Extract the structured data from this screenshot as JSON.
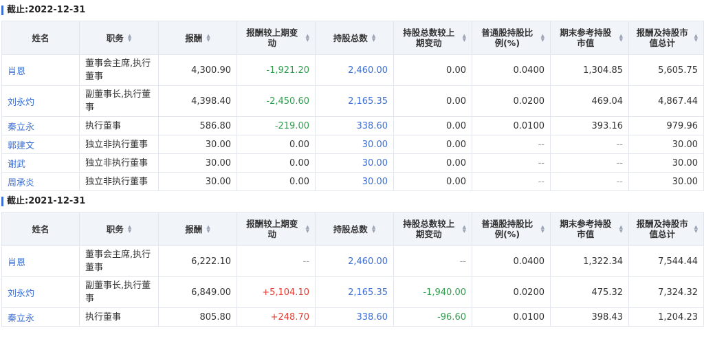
{
  "headers": [
    "姓名",
    "职务",
    "报酬",
    "报酬较上期变动",
    "持股总数",
    "持股总数较上期变动",
    "普通股持股比例(%)",
    "期末参考持股市值",
    "报酬及持股市值总计"
  ],
  "sections": [
    {
      "title": "截止:2022-12-31",
      "rows": [
        {
          "name": "肖恩",
          "duty": "董事会主席,执行董事",
          "pay": "4,300.90",
          "pay_chg": "-1,921.20",
          "shares": "2,460.00",
          "shares_chg": "0.00",
          "ratio": "0.0400",
          "value": "1,304.85",
          "total": "5,605.75"
        },
        {
          "name": "刘永灼",
          "duty": "副董事长,执行董事",
          "pay": "4,398.40",
          "pay_chg": "-2,450.60",
          "shares": "2,165.35",
          "shares_chg": "0.00",
          "ratio": "0.0200",
          "value": "469.04",
          "total": "4,867.44"
        },
        {
          "name": "秦立永",
          "duty": "执行董事",
          "pay": "586.80",
          "pay_chg": "-219.00",
          "shares": "338.60",
          "shares_chg": "0.00",
          "ratio": "0.0100",
          "value": "393.16",
          "total": "979.96"
        },
        {
          "name": "郭建文",
          "duty": "独立非执行董事",
          "pay": "30.00",
          "pay_chg": "0.00",
          "shares": "30.00",
          "shares_chg": "0.00",
          "ratio": "--",
          "value": "--",
          "total": "30.00"
        },
        {
          "name": "谢武",
          "duty": "独立非执行董事",
          "pay": "30.00",
          "pay_chg": "0.00",
          "shares": "30.00",
          "shares_chg": "0.00",
          "ratio": "--",
          "value": "--",
          "total": "30.00"
        },
        {
          "name": "周承炎",
          "duty": "独立非执行董事",
          "pay": "30.00",
          "pay_chg": "0.00",
          "shares": "30.00",
          "shares_chg": "0.00",
          "ratio": "--",
          "value": "--",
          "total": "30.00"
        }
      ]
    },
    {
      "title": "截止:2021-12-31",
      "rows": [
        {
          "name": "肖恩",
          "duty": "董事会主席,执行董事",
          "pay": "6,222.10",
          "pay_chg": "--",
          "shares": "2,460.00",
          "shares_chg": "--",
          "ratio": "0.0400",
          "value": "1,322.34",
          "total": "7,544.44"
        },
        {
          "name": "刘永灼",
          "duty": "副董事长,执行董事",
          "pay": "6,849.00",
          "pay_chg": "+5,104.10",
          "shares": "2,165.35",
          "shares_chg": "-1,940.00",
          "ratio": "0.0200",
          "value": "475.32",
          "total": "7,324.32"
        },
        {
          "name": "秦立永",
          "duty": "执行董事",
          "pay": "805.80",
          "pay_chg": "+248.70",
          "shares": "338.60",
          "shares_chg": "-96.60",
          "ratio": "0.0100",
          "value": "398.43",
          "total": "1,204.23"
        }
      ]
    }
  ]
}
